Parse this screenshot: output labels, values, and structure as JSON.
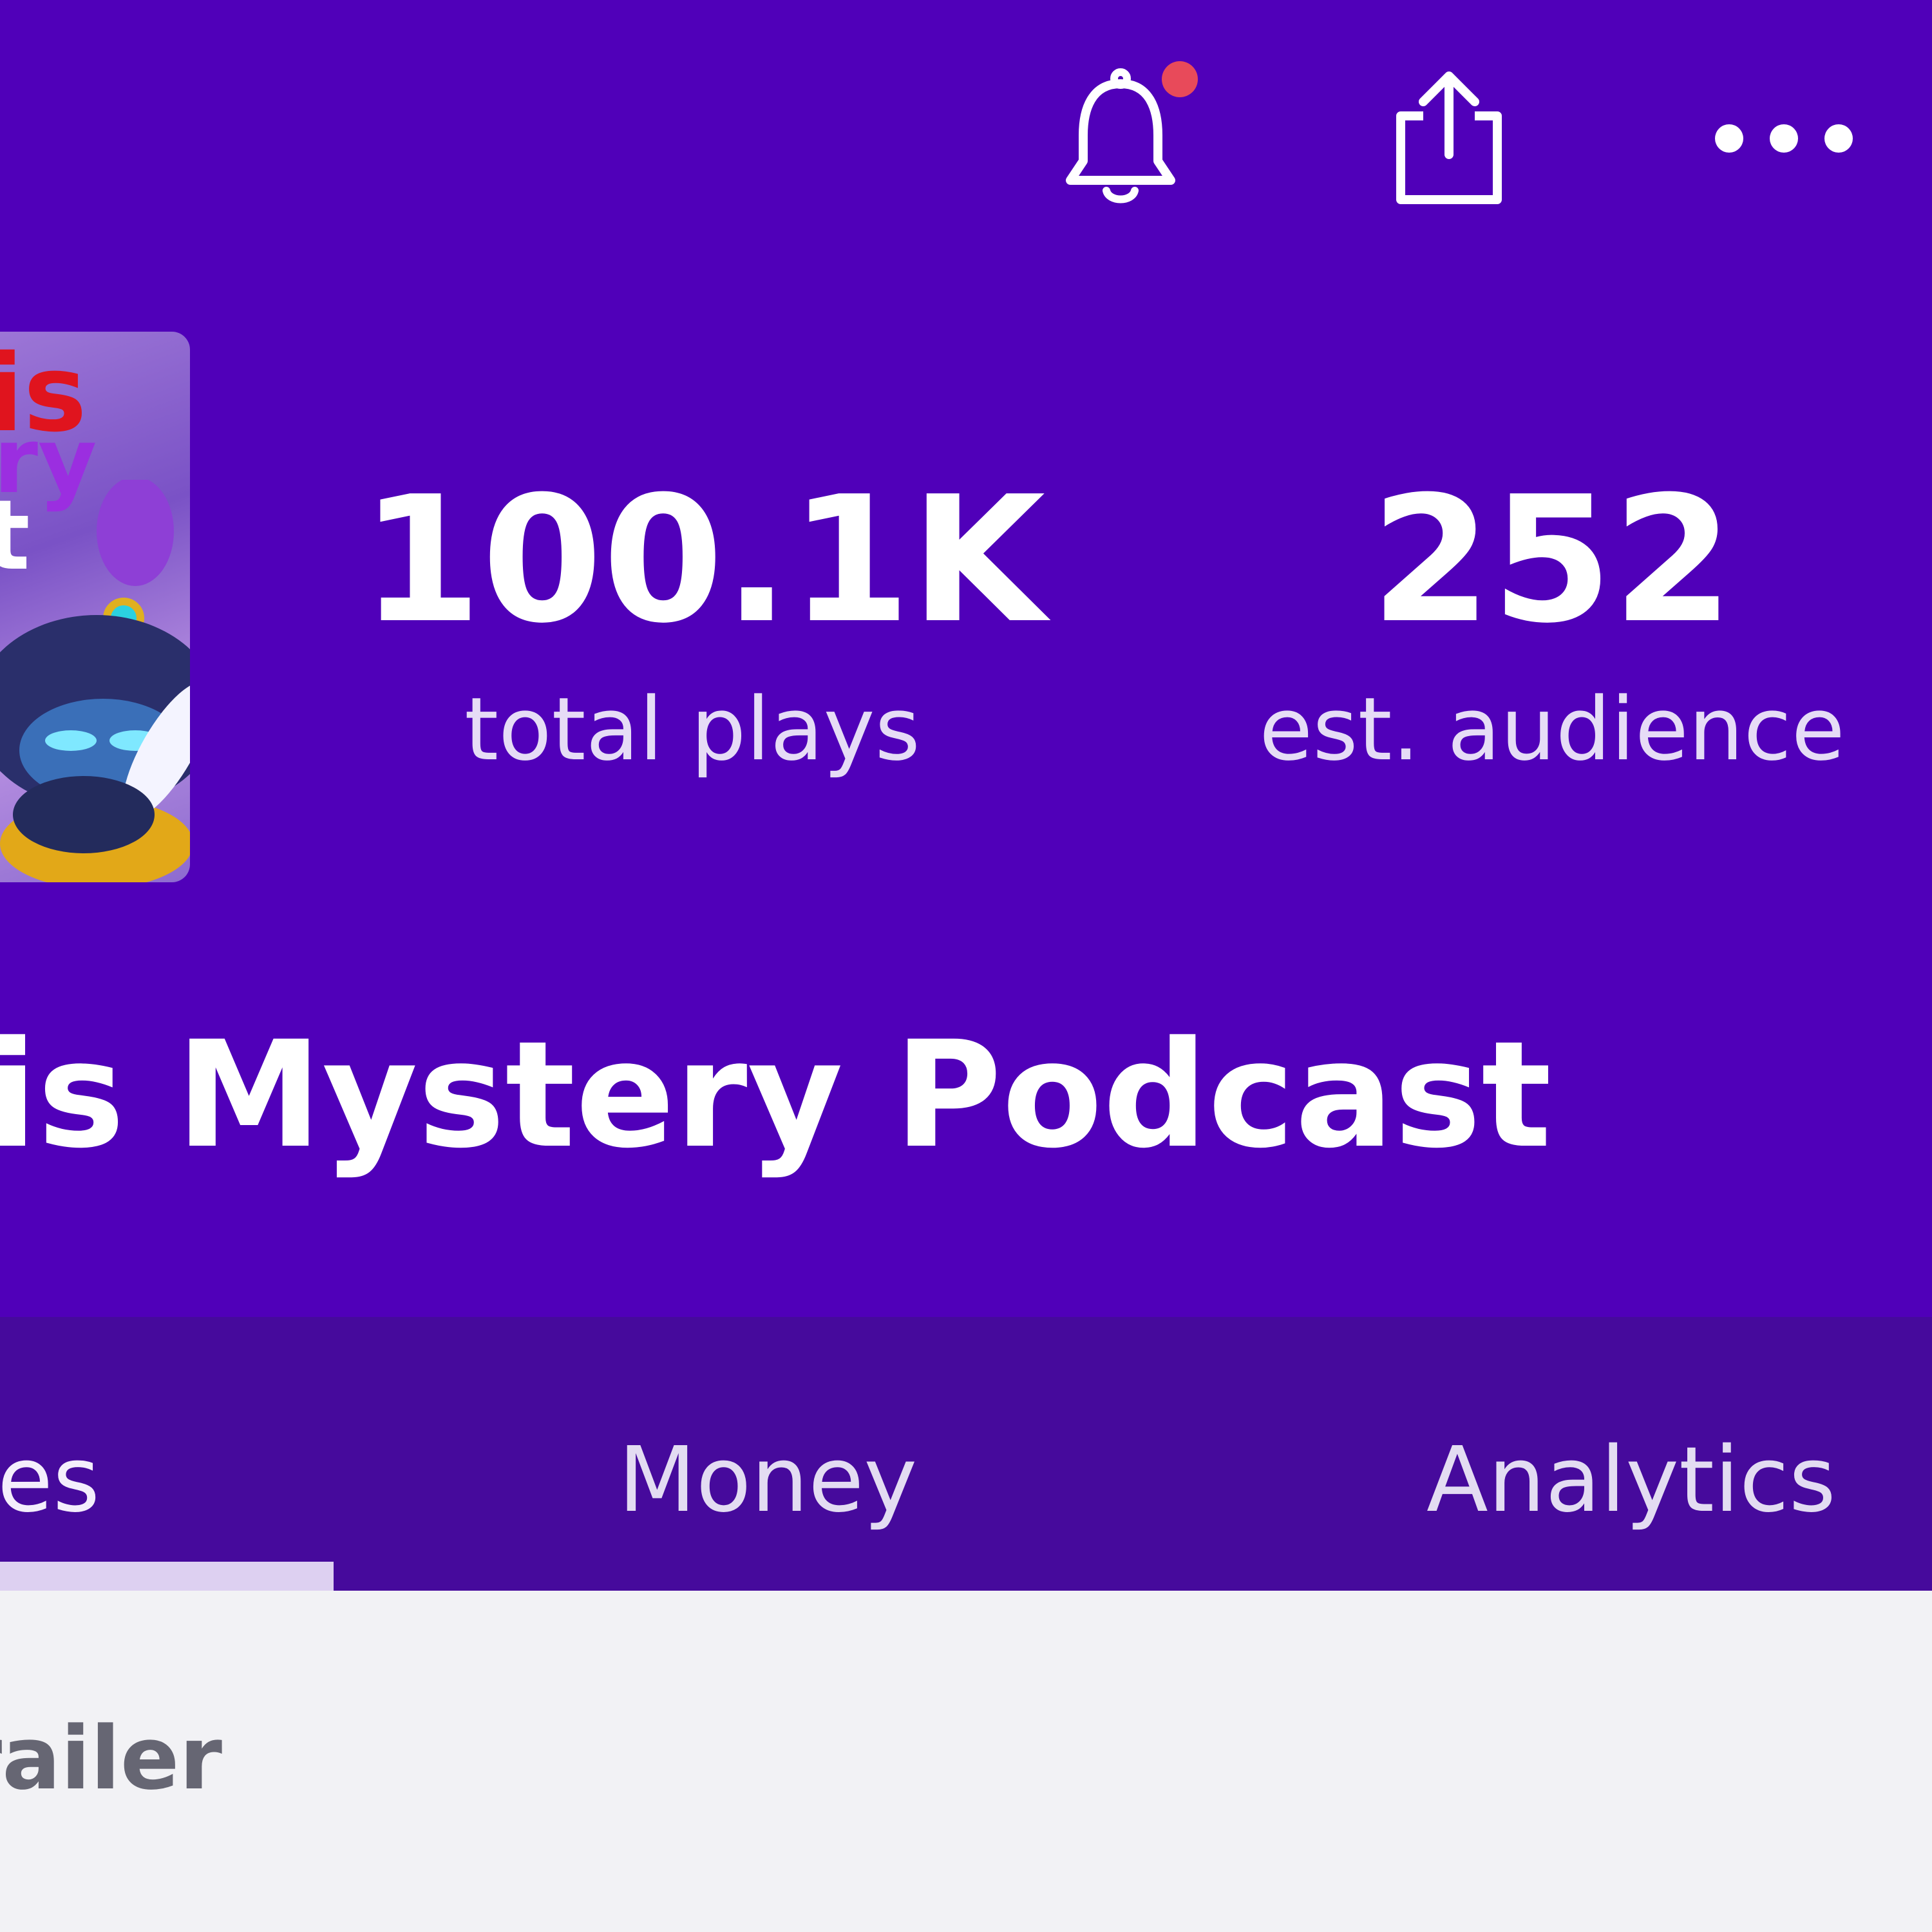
{
  "header": {
    "icons": {
      "bell": "bell-icon",
      "share": "share-icon",
      "more": "more-horizontal-icon"
    },
    "has_notification": true,
    "background_color": "#5000b9",
    "notification_dot_color": "#e84a5a"
  },
  "cover": {
    "line1": "is",
    "line2": "ry",
    "line3": "t"
  },
  "stats": {
    "total_plays_value": "100.1K",
    "total_plays_label": "total plays",
    "audience_value": "252",
    "audience_label": "est. audience"
  },
  "podcast": {
    "title": "is Mystery Podcast"
  },
  "tabs": {
    "items": [
      {
        "label": "es"
      },
      {
        "label": "Money"
      },
      {
        "label": "Analytics"
      }
    ],
    "background_color": "#460a9c"
  },
  "content": {
    "first_item_label": "railer"
  }
}
